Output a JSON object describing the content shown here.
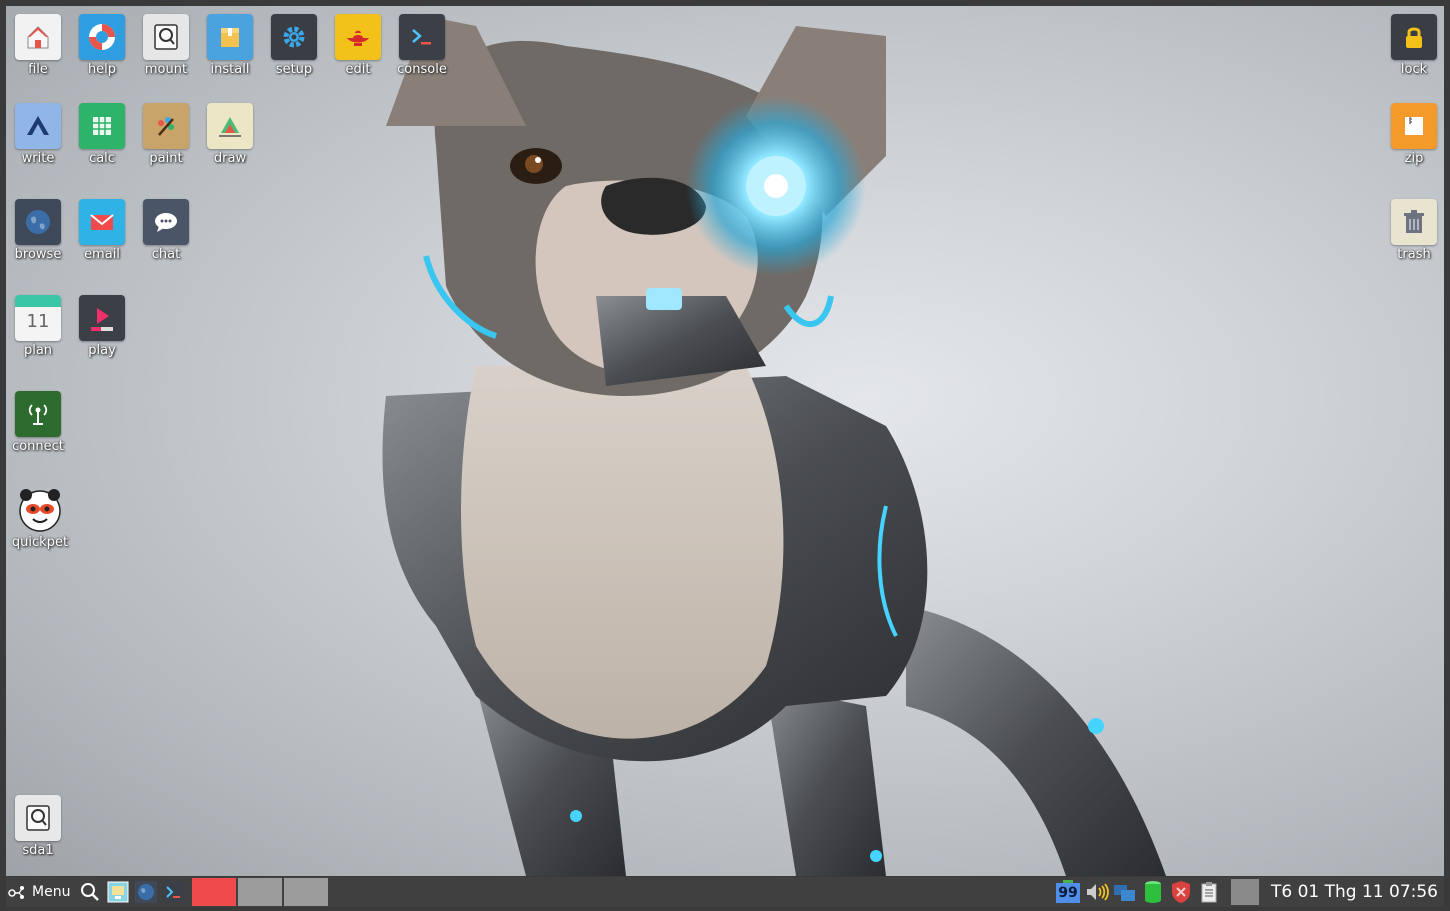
{
  "desktop": {
    "left_icons": [
      {
        "label": "file",
        "icon": "home-folder-icon",
        "color": "#f2f2f2"
      },
      {
        "label": "help",
        "icon": "lifebuoy-icon",
        "color": "#2f9ee0"
      },
      {
        "label": "mount",
        "icon": "harddisk-icon",
        "color": "#e6e6e6"
      },
      {
        "label": "install",
        "icon": "package-box-icon",
        "color": "#4aa3df"
      },
      {
        "label": "setup",
        "icon": "gear-icon",
        "color": "#3a3d44"
      },
      {
        "label": "edit",
        "icon": "genie-lamp-icon",
        "color": "#f3c21a"
      },
      {
        "label": "console",
        "icon": "terminal-icon",
        "color": "#3b4048"
      },
      {
        "label": "write",
        "icon": "write-doc-icon",
        "color": "#8fb6e6"
      },
      {
        "label": "calc",
        "icon": "spreadsheet-icon",
        "color": "#2eb36b"
      },
      {
        "label": "paint",
        "icon": "palette-icon",
        "color": "#c9a46a"
      },
      {
        "label": "draw",
        "icon": "draw-icon",
        "color": "#ece6c4"
      },
      {
        "label": "browse",
        "icon": "globe-icon",
        "color": "#3e4a5a"
      },
      {
        "label": "email",
        "icon": "envelope-icon",
        "color": "#2fb2e6"
      },
      {
        "label": "chat",
        "icon": "chat-bubble-icon",
        "color": "#4b5568"
      },
      {
        "label": "plan",
        "icon": "calendar-icon",
        "color": "#f4f4f4",
        "day": "11"
      },
      {
        "label": "play",
        "icon": "media-play-icon",
        "color": "#3c3f45"
      },
      {
        "label": "connect",
        "icon": "antenna-icon",
        "color": "#2e6b2e"
      },
      {
        "label": "quickpet",
        "icon": "quickpet-panda-icon",
        "color": "#e84a2a"
      },
      {
        "label": "sda1",
        "icon": "drive-partition-icon",
        "color": "#e8e8e8"
      }
    ],
    "right_icons": [
      {
        "label": "lock",
        "icon": "padlock-icon",
        "color": "#3a3d44"
      },
      {
        "label": "zip",
        "icon": "archive-icon",
        "color": "#f49a2a"
      },
      {
        "label": "trash",
        "icon": "trash-can-icon",
        "color": "#e9e4cf"
      }
    ]
  },
  "taskbar": {
    "menu_label": "Menu",
    "battery_value": "99",
    "clock": "T6 01 Thg 11 07:56",
    "task_colors": [
      "#ef4b4b",
      "#9c9c9c",
      "#9c9c9c"
    ]
  }
}
